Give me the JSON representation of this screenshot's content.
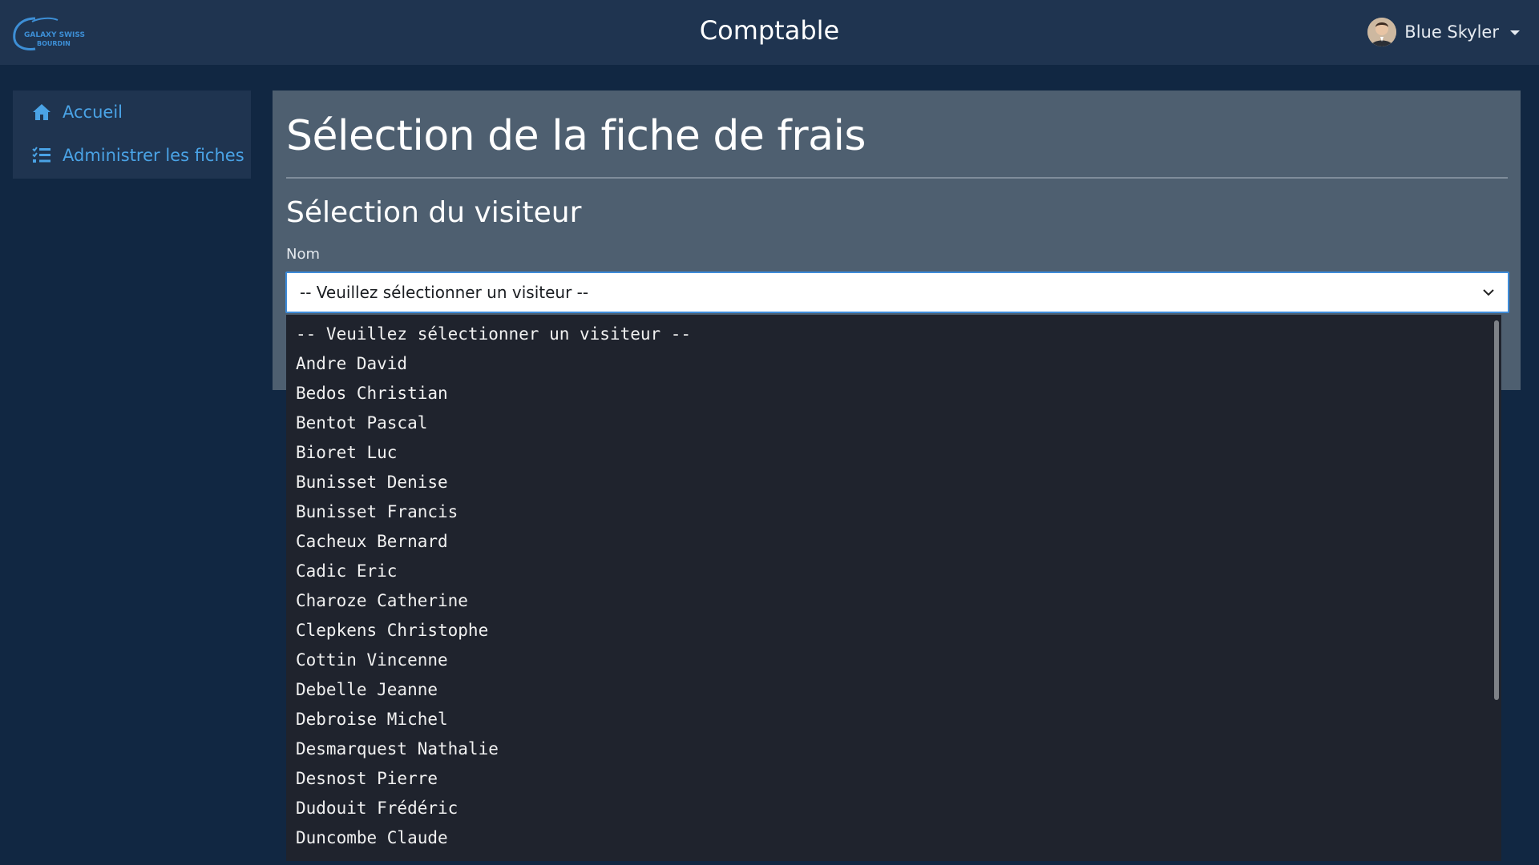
{
  "header": {
    "logo_text": "GALAXY SWISS BOURDIN",
    "app_title": "Comptable",
    "user_name": "Blue Skyler",
    "user_avatar_icon": "user-avatar",
    "caret_icon": "caret-down-icon"
  },
  "sidebar": {
    "items": [
      {
        "label": "Accueil",
        "icon": "home-icon"
      },
      {
        "label": "Administrer les fiches",
        "icon": "list-check-icon"
      }
    ]
  },
  "main": {
    "page_title": "Sélection de la fiche de frais",
    "section_title": "Sélection du visiteur",
    "field_label": "Nom",
    "select_value": "-- Veuillez sélectionner un visiteur --",
    "chevron_icon": "chevron-down-icon"
  },
  "dropdown": {
    "options": [
      "-- Veuillez sélectionner un visiteur --",
      "Andre David",
      "Bedos Christian",
      "Bentot Pascal",
      "Bioret Luc",
      "Bunisset Denise",
      "Bunisset Francis",
      "Cacheux Bernard",
      "Cadic Eric",
      "Charoze Catherine",
      "Clepkens Christophe",
      "Cottin Vincenne",
      "Debelle Jeanne",
      "Debroise Michel",
      "Desmarquest Nathalie",
      "Desnost Pierre",
      "Dudouit Frédéric",
      "Duncombe Claude"
    ]
  },
  "colors": {
    "background": "#112742",
    "navbar": "#1f3450",
    "card": "#4e5f70",
    "link": "#4aa3e6",
    "select_focus_border": "#3d8bd9",
    "dropdown_bg": "#1f232d"
  }
}
